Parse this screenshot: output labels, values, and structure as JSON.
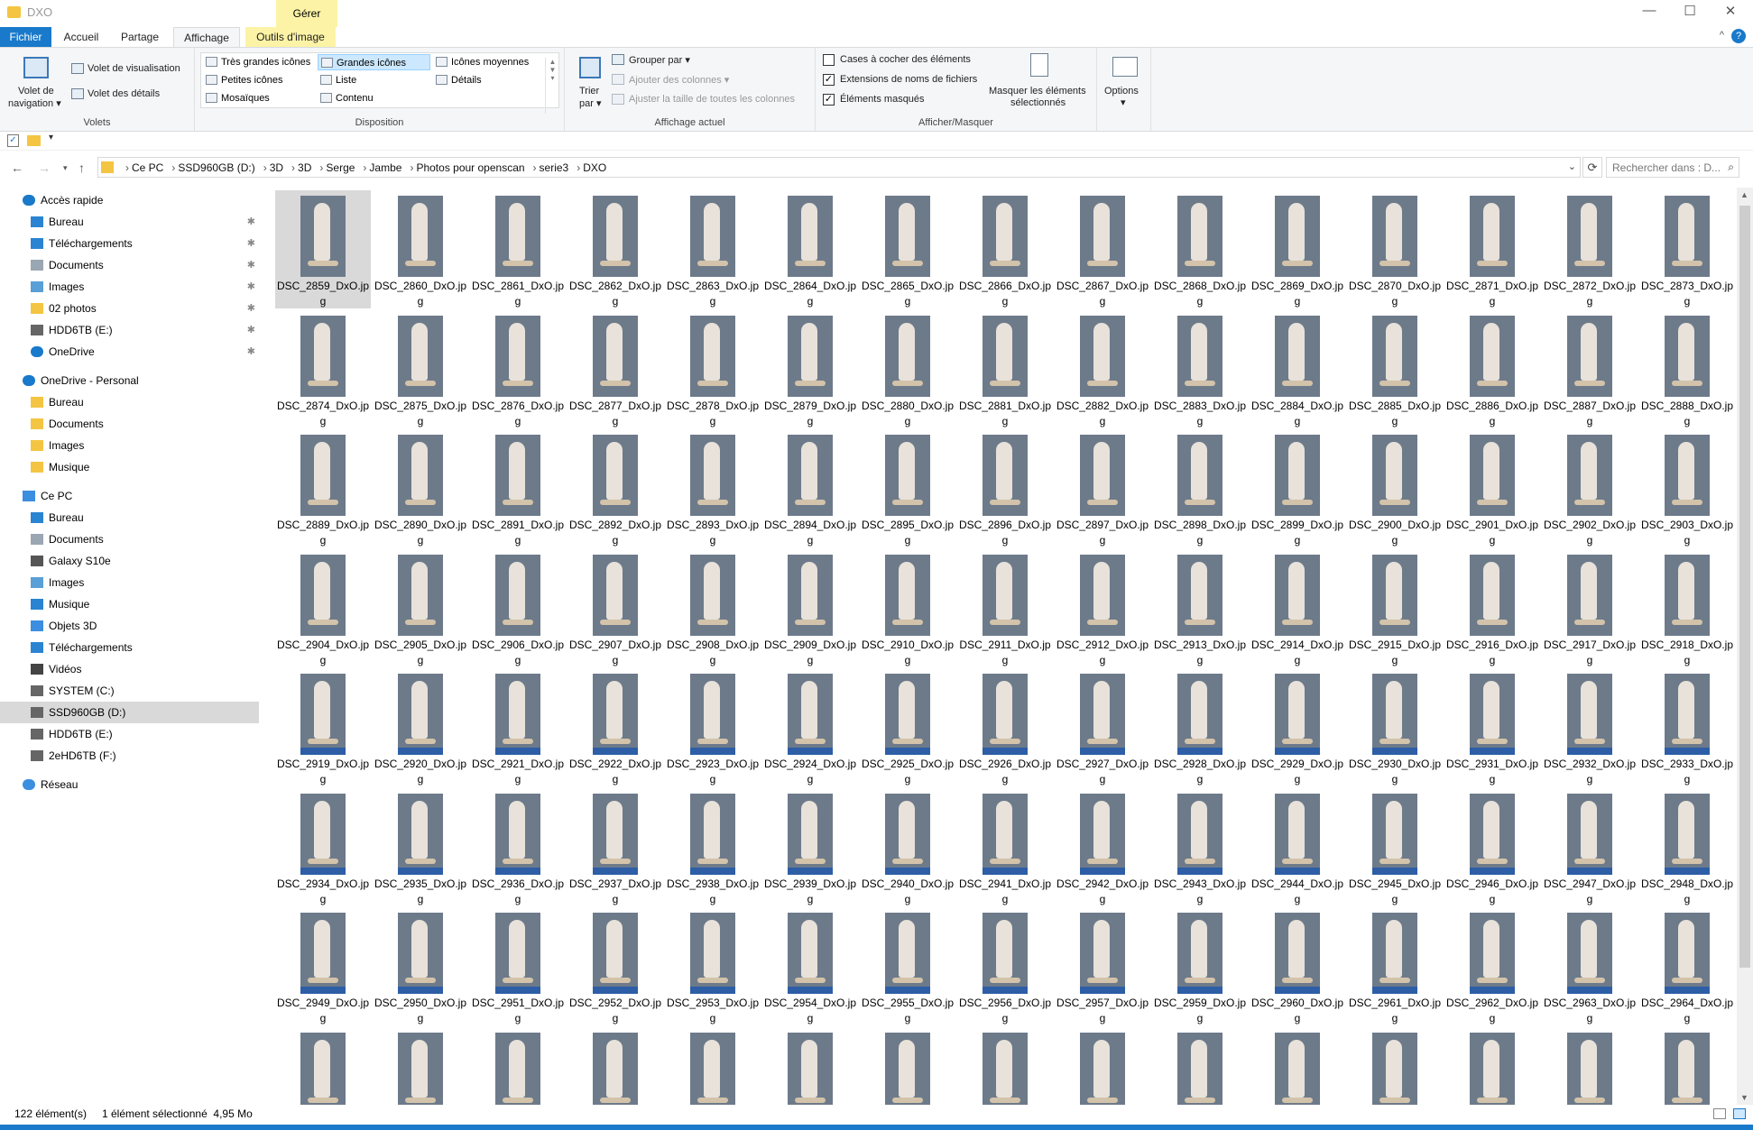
{
  "window": {
    "title": "DXO",
    "context_tab": "Gérer",
    "minimize": "—",
    "maximize": "☐",
    "close": "✕"
  },
  "tabs": {
    "fichier": "Fichier",
    "accueil": "Accueil",
    "partage": "Partage",
    "affichage": "Affichage",
    "outils": "Outils d'image"
  },
  "ribbon": {
    "volets": {
      "navigation_line1": "Volet de",
      "navigation_line2": "navigation ▾",
      "visualisation": "Volet de visualisation",
      "details": "Volet des détails",
      "label": "Volets"
    },
    "disposition": {
      "items": [
        "Très grandes icônes",
        "Grandes icônes",
        "Icônes moyennes",
        "Petites icônes",
        "Liste",
        "Détails",
        "Mosaïques",
        "Contenu"
      ],
      "selected": "Grandes icônes",
      "label": "Disposition"
    },
    "affichage_actuel": {
      "trier1": "Trier",
      "trier2": "par ▾",
      "grouper": "Grouper par ▾",
      "ajouter": "Ajouter des colonnes ▾",
      "ajuster": "Ajuster la taille de toutes les colonnes",
      "label": "Affichage actuel"
    },
    "afficher": {
      "cases": "Cases à cocher des éléments",
      "extensions": "Extensions de noms de fichiers",
      "masques": "Éléments masqués",
      "masquer1": "Masquer les éléments",
      "masquer2": "sélectionnés",
      "label": "Afficher/Masquer"
    },
    "options": {
      "label": "Options",
      "arrow": "▾"
    }
  },
  "address": {
    "crumbs": [
      "Ce PC",
      "SSD960GB (D:)",
      "3D",
      "3D",
      "Serge",
      "Jambe",
      "Photos pour openscan",
      "serie3",
      "DXO"
    ],
    "search_placeholder": "Rechercher dans : D..."
  },
  "sidebar": [
    {
      "label": "Accès rapide",
      "indent": 0,
      "icon": "star-icon",
      "color": "#1979ca"
    },
    {
      "label": "Bureau",
      "indent": 1,
      "icon": "desktop-icon",
      "color": "#2a84d2",
      "pin": true
    },
    {
      "label": "Téléchargements",
      "indent": 1,
      "icon": "download-icon",
      "color": "#2a84d2",
      "pin": true
    },
    {
      "label": "Documents",
      "indent": 1,
      "icon": "documents-icon",
      "color": "#9aa6b2",
      "pin": true
    },
    {
      "label": "Images",
      "indent": 1,
      "icon": "images-icon",
      "color": "#5a9fd6",
      "pin": true
    },
    {
      "label": "02 photos",
      "indent": 1,
      "icon": "folder-icon",
      "color": "#f4c542",
      "pin": true
    },
    {
      "label": "HDD6TB (E:)",
      "indent": 1,
      "icon": "drive-icon",
      "color": "#666",
      "pin": true
    },
    {
      "label": "OneDrive",
      "indent": 1,
      "icon": "cloud-icon",
      "color": "#1979ca",
      "pin": true
    },
    {
      "label": "OneDrive - Personal",
      "indent": 0,
      "icon": "cloud-icon",
      "color": "#1979ca",
      "gap": true
    },
    {
      "label": "Bureau",
      "indent": 1,
      "icon": "folder-icon",
      "color": "#f4c542"
    },
    {
      "label": "Documents",
      "indent": 1,
      "icon": "folder-icon",
      "color": "#f4c542"
    },
    {
      "label": "Images",
      "indent": 1,
      "icon": "folder-icon",
      "color": "#f4c542"
    },
    {
      "label": "Musique",
      "indent": 1,
      "icon": "folder-icon",
      "color": "#f4c542"
    },
    {
      "label": "Ce PC",
      "indent": 0,
      "icon": "computer-icon",
      "color": "#3b8ee0",
      "gap": true
    },
    {
      "label": "Bureau",
      "indent": 1,
      "icon": "desktop-icon",
      "color": "#2a84d2"
    },
    {
      "label": "Documents",
      "indent": 1,
      "icon": "documents-icon",
      "color": "#9aa6b2"
    },
    {
      "label": "Galaxy S10e",
      "indent": 1,
      "icon": "phone-icon",
      "color": "#555"
    },
    {
      "label": "Images",
      "indent": 1,
      "icon": "images-icon",
      "color": "#5a9fd6"
    },
    {
      "label": "Musique",
      "indent": 1,
      "icon": "music-icon",
      "color": "#2a84d2"
    },
    {
      "label": "Objets 3D",
      "indent": 1,
      "icon": "cube-icon",
      "color": "#3b8ee0"
    },
    {
      "label": "Téléchargements",
      "indent": 1,
      "icon": "download-icon",
      "color": "#2a84d2"
    },
    {
      "label": "Vidéos",
      "indent": 1,
      "icon": "video-icon",
      "color": "#444"
    },
    {
      "label": "SYSTEM (C:)",
      "indent": 1,
      "icon": "drive-icon",
      "color": "#666"
    },
    {
      "label": "SSD960GB (D:)",
      "indent": 1,
      "icon": "drive-icon",
      "color": "#666",
      "selected": true
    },
    {
      "label": "HDD6TB (E:)",
      "indent": 1,
      "icon": "drive-icon",
      "color": "#666"
    },
    {
      "label": "2eHD6TB (F:)",
      "indent": 1,
      "icon": "drive-icon",
      "color": "#666"
    },
    {
      "label": "Réseau",
      "indent": 0,
      "icon": "network-icon",
      "color": "#3b8ee0",
      "gap": true
    }
  ],
  "files": [
    "DSC_2859_DxO.jpg",
    "DSC_2860_DxO.jpg",
    "DSC_2861_DxO.jpg",
    "DSC_2862_DxO.jpg",
    "DSC_2863_DxO.jpg",
    "DSC_2864_DxO.jpg",
    "DSC_2865_DxO.jpg",
    "DSC_2866_DxO.jpg",
    "DSC_2867_DxO.jpg",
    "DSC_2868_DxO.jpg",
    "DSC_2869_DxO.jpg",
    "DSC_2870_DxO.jpg",
    "DSC_2871_DxO.jpg",
    "DSC_2872_DxO.jpg",
    "DSC_2873_DxO.jpg",
    "DSC_2874_DxO.jpg",
    "DSC_2875_DxO.jpg",
    "DSC_2876_DxO.jpg",
    "DSC_2877_DxO.jpg",
    "DSC_2878_DxO.jpg",
    "DSC_2879_DxO.jpg",
    "DSC_2880_DxO.jpg",
    "DSC_2881_DxO.jpg",
    "DSC_2882_DxO.jpg",
    "DSC_2883_DxO.jpg",
    "DSC_2884_DxO.jpg",
    "DSC_2885_DxO.jpg",
    "DSC_2886_DxO.jpg",
    "DSC_2887_DxO.jpg",
    "DSC_2888_DxO.jpg",
    "DSC_2889_DxO.jpg",
    "DSC_2890_DxO.jpg",
    "DSC_2891_DxO.jpg",
    "DSC_2892_DxO.jpg",
    "DSC_2893_DxO.jpg",
    "DSC_2894_DxO.jpg",
    "DSC_2895_DxO.jpg",
    "DSC_2896_DxO.jpg",
    "DSC_2897_DxO.jpg",
    "DSC_2898_DxO.jpg",
    "DSC_2899_DxO.jpg",
    "DSC_2900_DxO.jpg",
    "DSC_2901_DxO.jpg",
    "DSC_2902_DxO.jpg",
    "DSC_2903_DxO.jpg",
    "DSC_2904_DxO.jpg",
    "DSC_2905_DxO.jpg",
    "DSC_2906_DxO.jpg",
    "DSC_2907_DxO.jpg",
    "DSC_2908_DxO.jpg",
    "DSC_2909_DxO.jpg",
    "DSC_2910_DxO.jpg",
    "DSC_2911_DxO.jpg",
    "DSC_2912_DxO.jpg",
    "DSC_2913_DxO.jpg",
    "DSC_2914_DxO.jpg",
    "DSC_2915_DxO.jpg",
    "DSC_2916_DxO.jpg",
    "DSC_2917_DxO.jpg",
    "DSC_2918_DxO.jpg",
    "DSC_2919_DxO.jpg",
    "DSC_2920_DxO.jpg",
    "DSC_2921_DxO.jpg",
    "DSC_2922_DxO.jpg",
    "DSC_2923_DxO.jpg",
    "DSC_2924_DxO.jpg",
    "DSC_2925_DxO.jpg",
    "DSC_2926_DxO.jpg",
    "DSC_2927_DxO.jpg",
    "DSC_2928_DxO.jpg",
    "DSC_2929_DxO.jpg",
    "DSC_2930_DxO.jpg",
    "DSC_2931_DxO.jpg",
    "DSC_2932_DxO.jpg",
    "DSC_2933_DxO.jpg",
    "DSC_2934_DxO.jpg",
    "DSC_2935_DxO.jpg",
    "DSC_2936_DxO.jpg",
    "DSC_2937_DxO.jpg",
    "DSC_2938_DxO.jpg",
    "DSC_2939_DxO.jpg",
    "DSC_2940_DxO.jpg",
    "DSC_2941_DxO.jpg",
    "DSC_2942_DxO.jpg",
    "DSC_2943_DxO.jpg",
    "DSC_2944_DxO.jpg",
    "DSC_2945_DxO.jpg",
    "DSC_2946_DxO.jpg",
    "DSC_2947_DxO.jpg",
    "DSC_2948_DxO.jpg",
    "DSC_2949_DxO.jpg",
    "DSC_2950_DxO.jpg",
    "DSC_2951_DxO.jpg",
    "DSC_2952_DxO.jpg",
    "DSC_2953_DxO.jpg",
    "DSC_2954_DxO.jpg",
    "DSC_2955_DxO.jpg",
    "DSC_2956_DxO.jpg",
    "DSC_2957_DxO.jpg",
    "DSC_2959_DxO.jpg",
    "DSC_2960_DxO.jpg",
    "DSC_2961_DxO.jpg",
    "DSC_2962_DxO.jpg",
    "DSC_2963_DxO.jpg",
    "DSC_2964_DxO.jpg"
  ],
  "partial_row_count": 15,
  "selected_file": "DSC_2859_DxO.jpg",
  "status": {
    "count": "122 élément(s)",
    "selection": "1 élément sélectionné  4,95 Mo"
  },
  "colors": {
    "accent": "#1979ca",
    "context_tab": "#fdf3a6",
    "selection": "#cce8ff",
    "folder": "#f4c542"
  }
}
